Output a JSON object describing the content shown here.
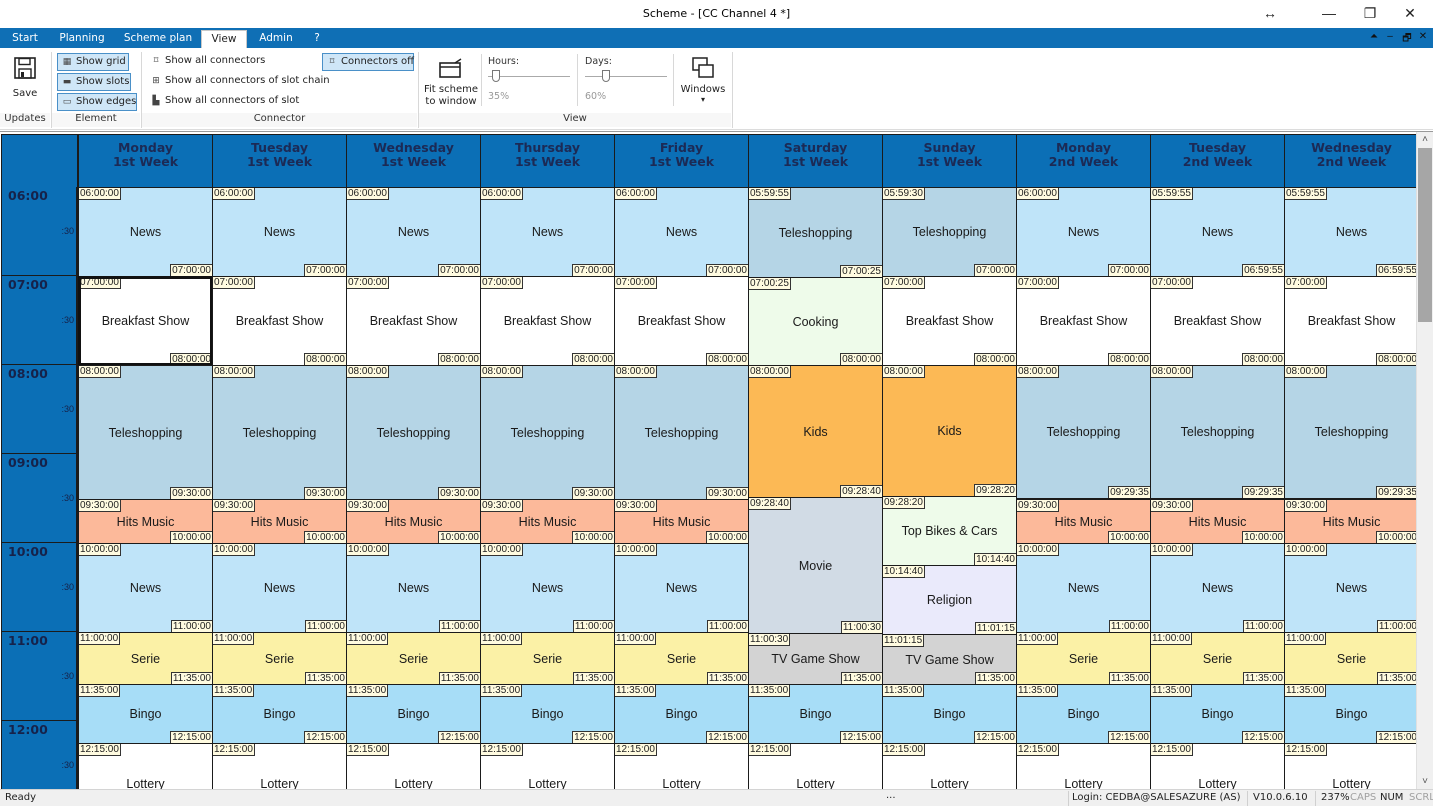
{
  "window": {
    "title": "Scheme - [CC Channel 4 *]",
    "controls": {
      "resize": "↔",
      "minimize": "—",
      "maximize": "❐",
      "close": "✕"
    }
  },
  "menu": {
    "tabs": [
      {
        "label": "Start",
        "active": false
      },
      {
        "label": "Planning",
        "active": false
      },
      {
        "label": "Scheme plan",
        "active": false
      },
      {
        "label": "View",
        "active": true
      },
      {
        "label": "Admin",
        "active": false
      },
      {
        "label": "?",
        "active": false
      }
    ],
    "mdi_controls": {
      "ribbon_toggle": "⏶",
      "minimize": "–",
      "restore": "🗗",
      "close": "✕"
    }
  },
  "ribbon": {
    "updates": {
      "save_label": "Save",
      "group_label": "Updates"
    },
    "element": {
      "group_label": "Element",
      "buttons": [
        {
          "label": "Show grid",
          "icon": "grid-icon",
          "checked": true
        },
        {
          "label": "Show slots",
          "icon": "slots-icon",
          "checked": true
        },
        {
          "label": "Show edges",
          "icon": "edges-icon",
          "checked": true
        }
      ]
    },
    "connector": {
      "group_label": "Connector",
      "buttons": [
        {
          "label": "Show all connectors",
          "icon": "connector-icon"
        },
        {
          "label": "Show all connectors of slot chain",
          "icon": "slot-chain-connector-icon"
        },
        {
          "label": "Show all connectors of slot",
          "icon": "slot-connector-icon"
        }
      ],
      "connectors_off": {
        "label": "Connectors off",
        "checked": true
      }
    },
    "view": {
      "group_label": "View",
      "fit_label_1": "Fit scheme",
      "fit_label_2": "to window",
      "hours": {
        "label": "Hours:",
        "value": "35%",
        "fraction": 0.1
      },
      "days": {
        "label": "Days:",
        "value": "60%",
        "fraction": 0.25
      },
      "windows_label": "Windows",
      "windows_caret": "▾"
    }
  },
  "scheme": {
    "days": [
      {
        "day": "Monday",
        "week": "1st Week"
      },
      {
        "day": "Tuesday",
        "week": "1st Week"
      },
      {
        "day": "Wednesday",
        "week": "1st Week"
      },
      {
        "day": "Thursday",
        "week": "1st Week"
      },
      {
        "day": "Friday",
        "week": "1st Week"
      },
      {
        "day": "Saturday",
        "week": "1st Week"
      },
      {
        "day": "Sunday",
        "week": "1st Week"
      },
      {
        "day": "Monday",
        "week": "2nd Week"
      },
      {
        "day": "Tuesday",
        "week": "2nd Week"
      },
      {
        "day": "Wednesday",
        "week": "2nd Week"
      }
    ],
    "hours": [
      "06:00",
      "07:00",
      "08:00",
      "09:00",
      "10:00",
      "11:00",
      "12:00"
    ],
    "half_label": ":30",
    "colors": {
      "News": "#bfe4f9",
      "Breakfast Show": "#ffffff",
      "Teleshopping": "#b5d5e6",
      "Hits Music": "#fcb99a",
      "Serie": "#fbf1a6",
      "Bingo": "#a7ddf7",
      "Lottery": "#ffffff",
      "Cooking": "#eefbea",
      "Kids": "#fcb955",
      "Movie": "#d1dbe5",
      "Top Bikes & Cars": "#eefbea",
      "Religion": "#eaeafb",
      "TV Game Show": "#d3d3d3"
    },
    "programs": [
      [
        {
          "name": "News",
          "start": "06:00:00",
          "end": "07:00:00"
        },
        {
          "name": "Breakfast Show",
          "start": "07:00:00",
          "end": "08:00:00",
          "selected": true
        },
        {
          "name": "Teleshopping",
          "start": "08:00:00",
          "end": "09:30:00"
        },
        {
          "name": "Hits Music",
          "start": "09:30:00",
          "end": "10:00:00"
        },
        {
          "name": "News",
          "start": "10:00:00",
          "end": "11:00:00"
        },
        {
          "name": "Serie",
          "start": "11:00:00",
          "end": "11:35:00"
        },
        {
          "name": "Bingo",
          "start": "11:35:00",
          "end": "12:15:00"
        },
        {
          "name": "Lottery",
          "start": "12:15:00",
          "end": ""
        }
      ],
      [
        {
          "name": "News",
          "start": "06:00:00",
          "end": "07:00:00"
        },
        {
          "name": "Breakfast Show",
          "start": "07:00:00",
          "end": "08:00:00"
        },
        {
          "name": "Teleshopping",
          "start": "08:00:00",
          "end": "09:30:00"
        },
        {
          "name": "Hits Music",
          "start": "09:30:00",
          "end": "10:00:00"
        },
        {
          "name": "News",
          "start": "10:00:00",
          "end": "11:00:00"
        },
        {
          "name": "Serie",
          "start": "11:00:00",
          "end": "11:35:00"
        },
        {
          "name": "Bingo",
          "start": "11:35:00",
          "end": "12:15:00"
        },
        {
          "name": "Lottery",
          "start": "12:15:00",
          "end": ""
        }
      ],
      [
        {
          "name": "News",
          "start": "06:00:00",
          "end": "07:00:00"
        },
        {
          "name": "Breakfast Show",
          "start": "07:00:00",
          "end": "08:00:00"
        },
        {
          "name": "Teleshopping",
          "start": "08:00:00",
          "end": "09:30:00"
        },
        {
          "name": "Hits Music",
          "start": "09:30:00",
          "end": "10:00:00"
        },
        {
          "name": "News",
          "start": "10:00:00",
          "end": "11:00:00"
        },
        {
          "name": "Serie",
          "start": "11:00:00",
          "end": "11:35:00"
        },
        {
          "name": "Bingo",
          "start": "11:35:00",
          "end": "12:15:00"
        },
        {
          "name": "Lottery",
          "start": "12:15:00",
          "end": ""
        }
      ],
      [
        {
          "name": "News",
          "start": "06:00:00",
          "end": "07:00:00"
        },
        {
          "name": "Breakfast Show",
          "start": "07:00:00",
          "end": "08:00:00"
        },
        {
          "name": "Teleshopping",
          "start": "08:00:00",
          "end": "09:30:00"
        },
        {
          "name": "Hits Music",
          "start": "09:30:00",
          "end": "10:00:00"
        },
        {
          "name": "News",
          "start": "10:00:00",
          "end": "11:00:00"
        },
        {
          "name": "Serie",
          "start": "11:00:00",
          "end": "11:35:00"
        },
        {
          "name": "Bingo",
          "start": "11:35:00",
          "end": "12:15:00"
        },
        {
          "name": "Lottery",
          "start": "12:15:00",
          "end": ""
        }
      ],
      [
        {
          "name": "News",
          "start": "06:00:00",
          "end": "07:00:00"
        },
        {
          "name": "Breakfast Show",
          "start": "07:00:00",
          "end": "08:00:00"
        },
        {
          "name": "Teleshopping",
          "start": "08:00:00",
          "end": "09:30:00"
        },
        {
          "name": "Hits Music",
          "start": "09:30:00",
          "end": "10:00:00"
        },
        {
          "name": "News",
          "start": "10:00:00",
          "end": "11:00:00"
        },
        {
          "name": "Serie",
          "start": "11:00:00",
          "end": "11:35:00"
        },
        {
          "name": "Bingo",
          "start": "11:35:00",
          "end": "12:15:00"
        },
        {
          "name": "Lottery",
          "start": "12:15:00",
          "end": ""
        }
      ],
      [
        {
          "name": "Teleshopping",
          "start": "05:59:55",
          "end": "07:00:25"
        },
        {
          "name": "Cooking",
          "start": "07:00:25",
          "end": "08:00:00"
        },
        {
          "name": "Kids",
          "start": "08:00:00",
          "end": "09:28:40"
        },
        {
          "name": "Movie",
          "start": "09:28:40",
          "end": "11:00:30"
        },
        {
          "name": "TV Game Show",
          "start": "11:00:30",
          "end": "11:35:00"
        },
        {
          "name": "Bingo",
          "start": "11:35:00",
          "end": "12:15:00"
        },
        {
          "name": "Lottery",
          "start": "12:15:00",
          "end": ""
        }
      ],
      [
        {
          "name": "Teleshopping",
          "start": "05:59:30",
          "end": "07:00:00"
        },
        {
          "name": "Breakfast Show",
          "start": "07:00:00",
          "end": "08:00:00"
        },
        {
          "name": "Kids",
          "start": "08:00:00",
          "end": "09:28:20"
        },
        {
          "name": "Top Bikes & Cars",
          "start": "09:28:20",
          "end": "10:14:40"
        },
        {
          "name": "Religion",
          "start": "10:14:40",
          "end": "11:01:15"
        },
        {
          "name": "TV Game Show",
          "start": "11:01:15",
          "end": "11:35:00"
        },
        {
          "name": "Bingo",
          "start": "11:35:00",
          "end": "12:15:00"
        },
        {
          "name": "Lottery",
          "start": "12:15:00",
          "end": ""
        }
      ],
      [
        {
          "name": "News",
          "start": "06:00:00",
          "end": "07:00:00"
        },
        {
          "name": "Breakfast Show",
          "start": "07:00:00",
          "end": "08:00:00"
        },
        {
          "name": "Teleshopping",
          "start": "08:00:00",
          "end": "09:29:35"
        },
        {
          "name": "Hits Music",
          "start": "09:30:00",
          "end": "10:00:00"
        },
        {
          "name": "News",
          "start": "10:00:00",
          "end": "11:00:00"
        },
        {
          "name": "Serie",
          "start": "11:00:00",
          "end": "11:35:00"
        },
        {
          "name": "Bingo",
          "start": "11:35:00",
          "end": "12:15:00"
        },
        {
          "name": "Lottery",
          "start": "12:15:00",
          "end": ""
        }
      ],
      [
        {
          "name": "News",
          "start": "05:59:55",
          "end": "06:59:55"
        },
        {
          "name": "Breakfast Show",
          "start": "07:00:00",
          "end": "08:00:00"
        },
        {
          "name": "Teleshopping",
          "start": "08:00:00",
          "end": "09:29:35"
        },
        {
          "name": "Hits Music",
          "start": "09:30:00",
          "end": "10:00:00"
        },
        {
          "name": "News",
          "start": "10:00:00",
          "end": "11:00:00"
        },
        {
          "name": "Serie",
          "start": "11:00:00",
          "end": "11:35:00"
        },
        {
          "name": "Bingo",
          "start": "11:35:00",
          "end": "12:15:00"
        },
        {
          "name": "Lottery",
          "start": "12:15:00",
          "end": ""
        }
      ],
      [
        {
          "name": "News",
          "start": "05:59:55",
          "end": "06:59:55"
        },
        {
          "name": "Breakfast Show",
          "start": "07:00:00",
          "end": "08:00:00"
        },
        {
          "name": "Teleshopping",
          "start": "08:00:00",
          "end": "09:29:35"
        },
        {
          "name": "Hits Music",
          "start": "09:30:00",
          "end": "10:00:00"
        },
        {
          "name": "News",
          "start": "10:00:00",
          "end": "11:00:00"
        },
        {
          "name": "Serie",
          "start": "11:00:00",
          "end": "11:35:00"
        },
        {
          "name": "Bingo",
          "start": "11:35:00",
          "end": "12:15:00"
        },
        {
          "name": "Lottery",
          "start": "12:15:00",
          "end": ""
        }
      ]
    ],
    "scroll_up": "˄",
    "scroll_down": "˅"
  },
  "status": {
    "state": "Ready",
    "ellipsis": "...",
    "login": "Login: CEDBA@SALESAZURE (AS)",
    "version": "V10.0.6.10",
    "zoom": "237%",
    "caps": "CAPS",
    "num": "NUM",
    "scrl": "SCRL"
  }
}
